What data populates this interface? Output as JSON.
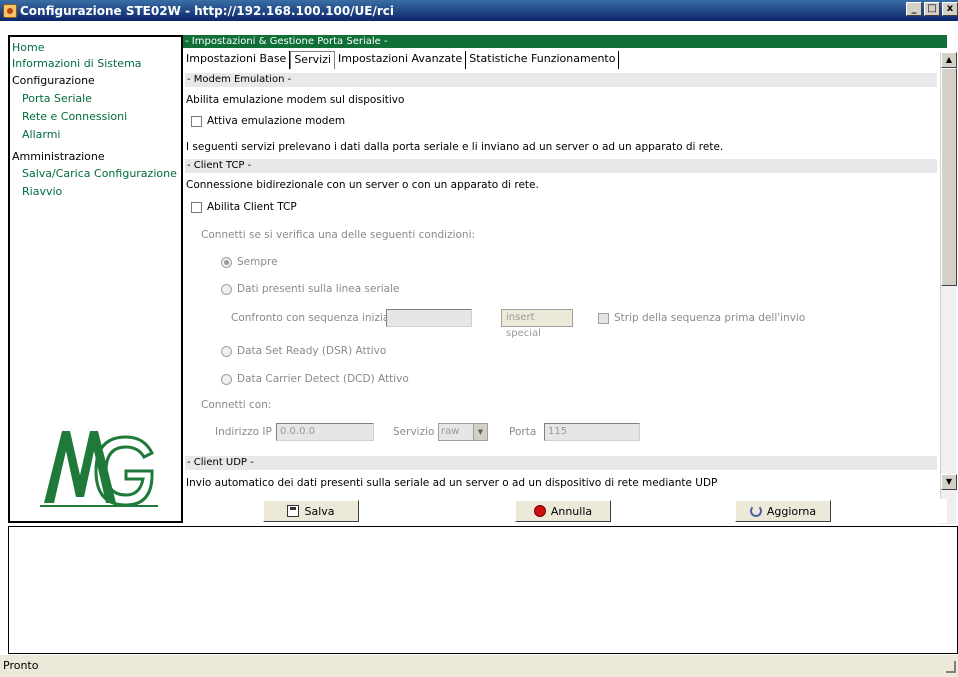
{
  "window": {
    "title": "Configurazione STE02W - http://192.168.100.100/UE/rci",
    "minimize": "_",
    "maximize": "□",
    "close": "x"
  },
  "sidebar": {
    "home": "Home",
    "info": "Informazioni di Sistema",
    "config_head": "Configurazione",
    "porta": "Porta Seriale",
    "rete": "Rete e Connessioni",
    "allarmi": "Allarmi",
    "admin_head": "Amministrazione",
    "salva_carica": "Salva/Carica Configurazione",
    "riavvio": "Riavvio"
  },
  "main": {
    "section_title": "- Impostazioni  & Gestione Porta Seriale -",
    "tabs": [
      {
        "label": "Impostazioni Base"
      },
      {
        "label": "Servizi"
      },
      {
        "label": "Impostazioni Avanzate"
      },
      {
        "label": "Statistiche Funzionamento"
      }
    ],
    "active_tab": "Servizi"
  },
  "content": {
    "modem_header": "- Modem Emulation -",
    "modem_desc": "Abilita emulazione modem sul dispositivo",
    "modem_checkbox": "Attiva emulazione modem",
    "services_desc": "I seguenti servizi prelevano i dati dalla porta seriale e li inviano ad un server o ad un apparato di rete.",
    "tcp_header": "- Client TCP -",
    "tcp_desc": "Connessione bidirezionale con un server o con un apparato di rete.",
    "tcp_checkbox": "Abilita Client TCP",
    "connect_if": "Connetti se si verifica una delle seguenti condizioni:",
    "radio_sempre": "Sempre",
    "radio_dati": "Dati presenti sulla linea seriale",
    "confronto_label": "Confronto con sequenza iniziale",
    "confronto_value": "",
    "insert_special": "insert special",
    "strip_label": "Strip della sequenza prima dell'invio",
    "radio_dsr": "Data Set Ready (DSR) Attivo",
    "radio_dcd": "Data Carrier Detect (DCD) Attivo",
    "connetti_con": "Connetti con:",
    "ip_label": "Indirizzo IP",
    "ip_value": "0.0.0.0",
    "servizio_label": "Servizio",
    "servizio_value": "raw",
    "porta_label": "Porta",
    "porta_value": "115",
    "udp_header": "- Client UDP -",
    "udp_desc": "Invio automatico dei dati presenti sulla seriale ad un server o ad un dispositivo di rete mediante UDP"
  },
  "actions": {
    "salva": "Salva",
    "annulla": "Annulla",
    "aggiorna": "Aggiorna"
  },
  "status": {
    "text": "Pronto"
  },
  "colors": {
    "accent_green": "#0f6f37",
    "link_green": "#006c3a",
    "titlebar": "#0a246a"
  }
}
